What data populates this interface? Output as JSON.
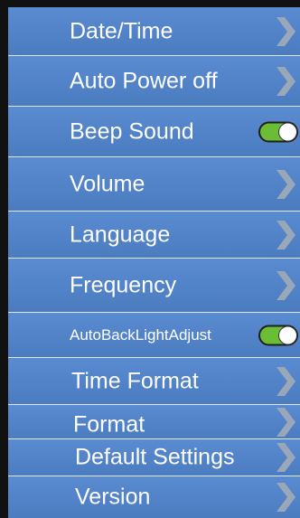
{
  "colors": {
    "row_background": "#5a8bd1",
    "frame": "#111111",
    "text": "#ffffff",
    "chevron": "#9aa7b8",
    "toggle_on": "#6bbd35"
  },
  "menu": {
    "items": [
      {
        "label": "Date/Time",
        "control": "chevron-right-icon"
      },
      {
        "label": "Auto Power off",
        "control": "chevron-right-icon"
      },
      {
        "label": "Beep Sound",
        "control": "toggle",
        "state": "on"
      },
      {
        "label": "Volume",
        "control": "chevron-right-icon"
      },
      {
        "label": "Language",
        "control": "chevron-right-icon"
      },
      {
        "label": "Frequency",
        "control": "chevron-right-icon"
      },
      {
        "label": "AutoBackLightAdjust",
        "control": "toggle",
        "state": "on"
      },
      {
        "label": "Time Format",
        "control": "chevron-right-icon"
      },
      {
        "label": "Format",
        "control": "chevron-right-icon"
      },
      {
        "label": "Default Settings",
        "control": "chevron-right-icon"
      },
      {
        "label": "Version",
        "control": "chevron-right-icon"
      }
    ]
  }
}
